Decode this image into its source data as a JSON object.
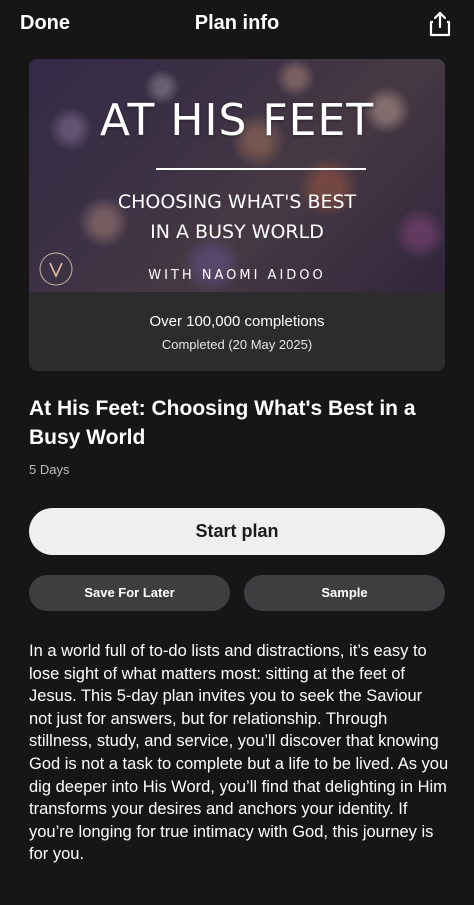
{
  "header": {
    "done_label": "Done",
    "title": "Plan info",
    "share_icon": "share-icon"
  },
  "hero": {
    "title": "AT HIS FEET",
    "subtitle_line1": "CHOOSING WHAT'S BEST",
    "subtitle_line2": "IN A BUSY WORLD",
    "author": "WITH NAOMI AIDOO",
    "completions": "Over 100,000 completions",
    "completed_date": "Completed (20 May 2025)"
  },
  "plan": {
    "title": "At His Feet: Choosing What's Best in a Busy World",
    "duration": "5 Days",
    "description": "In a world full of to-do lists and distractions, it’s easy to lose sight of what matters most: sitting at the feet of Jesus. This 5-day plan invites you to seek the Saviour not just for answers, but for relationship. Through stillness, study, and service, you’ll discover that knowing God is not a task to complete but a life to be lived. As you dig deeper into His Word, you’ll find that delighting in Him transforms your desires and anchors your identity. If you’re longing for true intimacy with God, this journey is for you."
  },
  "actions": {
    "start_label": "Start plan",
    "save_label": "Save For Later",
    "sample_label": "Sample"
  },
  "colors": {
    "background": "#161616",
    "primary_button": "#efefef",
    "secondary_button": "#3e3e40",
    "card_footer": "#2c2c2e"
  }
}
